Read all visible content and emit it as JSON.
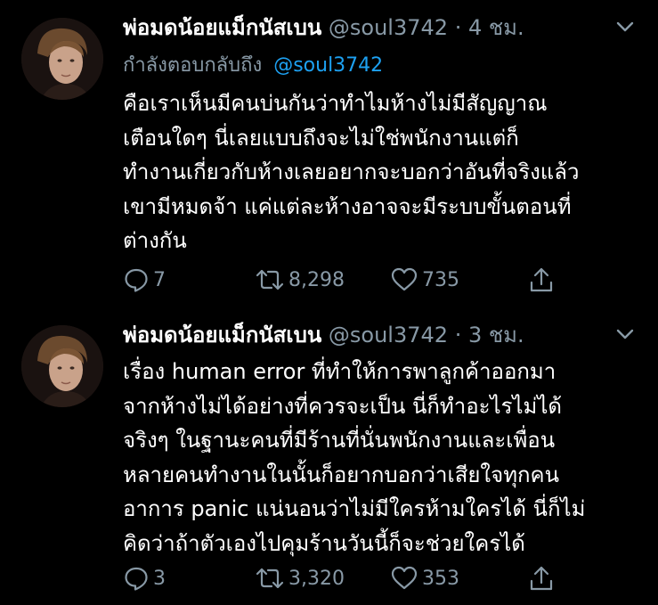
{
  "tweets": [
    {
      "display_name": "พ่อมดน้อยแม็กนัสเบน",
      "handle": "@soul3742",
      "separator": "·",
      "time": "4 ชม.",
      "reply_prefix": "กำลังตอบกลับถึง",
      "reply_handle": "@soul3742",
      "lines": [
        "คือเราเห็นมีคนบ่นกันว่าทำไมห้างไม่มีสัญญาณ",
        "เตือนใดๆ นี่เลยแบบถึงจะไม่ใช่พนักงานแต่ก็",
        "ทำงานเกี่ยวกับห้างเลยอยากจะบอกว่าอันที่จริงแล้ว",
        "เขามีหมดจ้า แค่แต่ละห้างอาจจะมีระบบขั้นตอนที่",
        "ต่างกัน"
      ],
      "replies": "7",
      "retweets": "8,298",
      "likes": "735"
    },
    {
      "display_name": "พ่อมดน้อยแม็กนัสเบน",
      "handle": "@soul3742",
      "separator": "·",
      "time": "3 ชม.",
      "lines": [
        "เรื่อง human error ที่ทำให้การพาลูกค้าออกมา",
        "จากห้างไม่ได้อย่างที่ควรจะเป็น นี่ก็ทำอะไรไม่ได้",
        "จริงๆ ในฐานะคนที่มีร้านที่นั่นพนักงานและเพื่อน",
        "หลายคนทำงานในนั้นก็อยากบอกว่าเสียใจทุกคน",
        "อาการ panic แน่นอนว่าไม่มีใครห้ามใครได้ นี่ก็ไม่",
        "คิดว่าถ้าตัวเองไปคุมร้านวันนี้ก็จะช่วยใครได้"
      ],
      "replies": "3",
      "retweets": "3,320",
      "likes": "353"
    }
  ],
  "icons": {
    "reply": "reply-icon",
    "retweet": "retweet-icon",
    "like": "heart-icon",
    "share": "share-icon",
    "more": "chevron-down-icon"
  },
  "colors": {
    "background": "#000000",
    "text": "#ffffff",
    "muted": "#8899a6",
    "link": "#1da1f2"
  }
}
